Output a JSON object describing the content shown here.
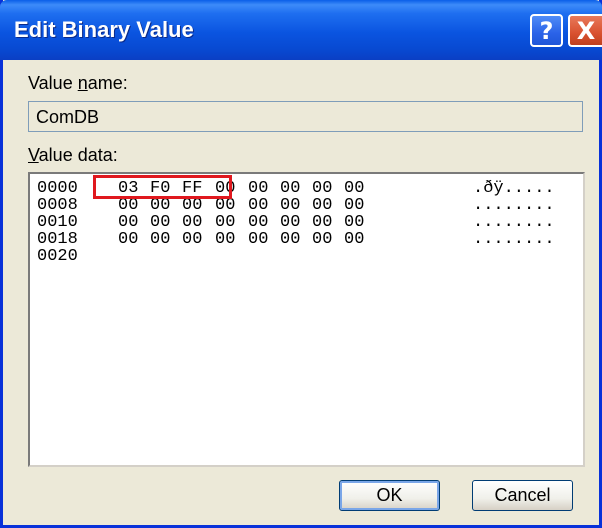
{
  "window": {
    "title": "Edit Binary Value",
    "help_glyph": "?",
    "close_glyph": "X"
  },
  "value_name": {
    "label_accel": "n",
    "label_pre": "Value ",
    "label_post": "ame:",
    "value": "ComDB"
  },
  "value_data": {
    "label_accel": "V",
    "label_post": "alue data:",
    "rows": [
      {
        "address": "0000",
        "bytes": [
          "03",
          "F0",
          "FF",
          "00",
          "00",
          "00",
          "00",
          "00"
        ],
        "ascii": ".ðÿ....."
      },
      {
        "address": "0008",
        "bytes": [
          "00",
          "00",
          "00",
          "00",
          "00",
          "00",
          "00",
          "00"
        ],
        "ascii": "........"
      },
      {
        "address": "0010",
        "bytes": [
          "00",
          "00",
          "00",
          "00",
          "00",
          "00",
          "00",
          "00"
        ],
        "ascii": "........"
      },
      {
        "address": "0018",
        "bytes": [
          "00",
          "00",
          "00",
          "00",
          "00",
          "00",
          "00",
          "00"
        ],
        "ascii": "........"
      },
      {
        "address": "0020",
        "bytes": [],
        "ascii": ""
      }
    ]
  },
  "buttons": {
    "ok": "OK",
    "cancel": "Cancel"
  },
  "colors": {
    "titlebar": "#0a54e0",
    "dialog_bg": "#ece9d8",
    "highlight_border": "#e0181e"
  }
}
